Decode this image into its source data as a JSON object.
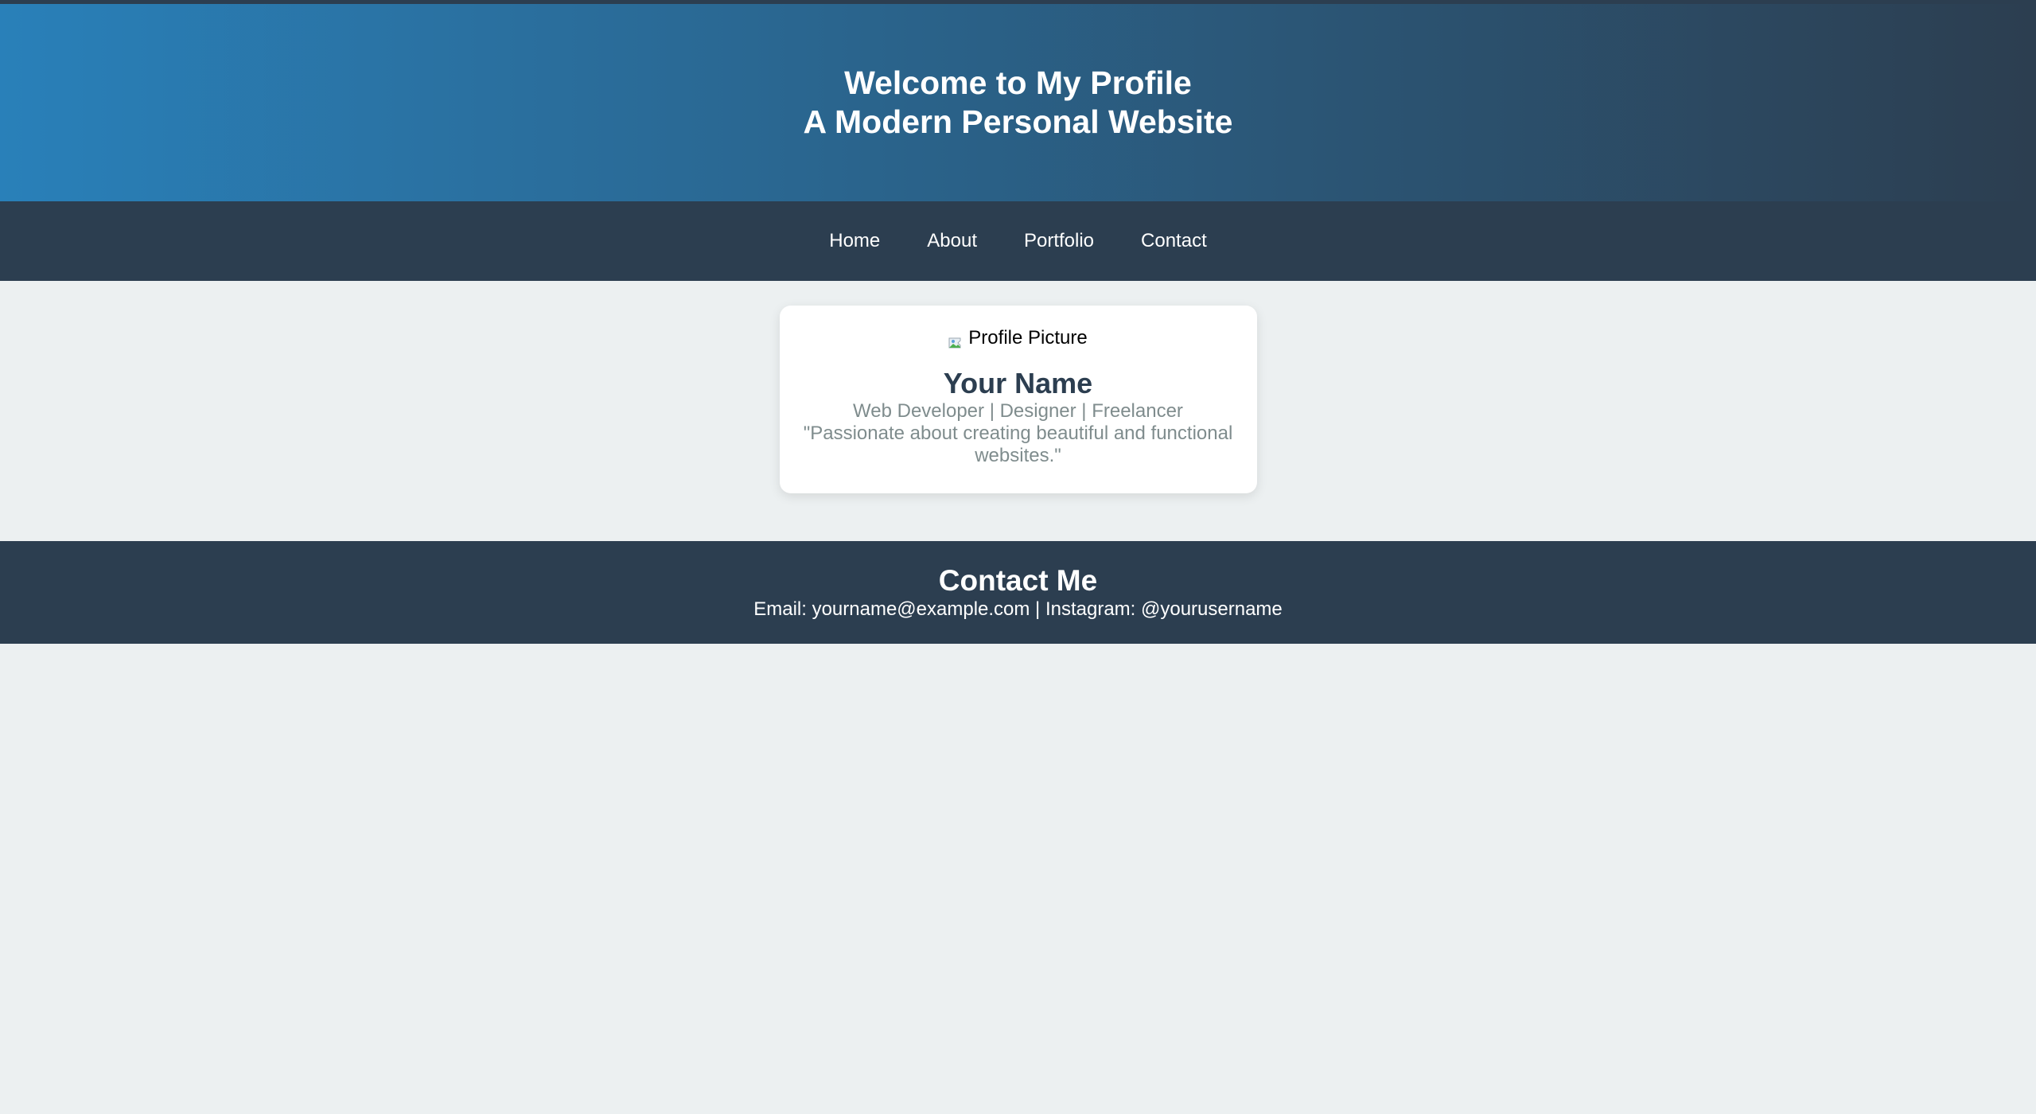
{
  "header": {
    "title": "Welcome to My Profile",
    "subtitle": "A Modern Personal Website"
  },
  "nav": {
    "items": [
      {
        "label": "Home"
      },
      {
        "label": "About"
      },
      {
        "label": "Portfolio"
      },
      {
        "label": "Contact"
      }
    ]
  },
  "profile": {
    "image_alt": "Profile Picture",
    "name": "Your Name",
    "role": "Web Developer | Designer | Freelancer",
    "quote": "\"Passionate about creating beautiful and functional websites.\""
  },
  "footer": {
    "title": "Contact Me",
    "contact_line": "Email: yourname@example.com | Instagram: @yourusername"
  },
  "colors": {
    "header_gradient_start": "#2980b9",
    "header_gradient_end": "#2c3e50",
    "nav_background": "#2c3e50",
    "page_background": "#ecf0f1",
    "card_name": "#2c3e50",
    "card_text": "#7f8c8d"
  }
}
